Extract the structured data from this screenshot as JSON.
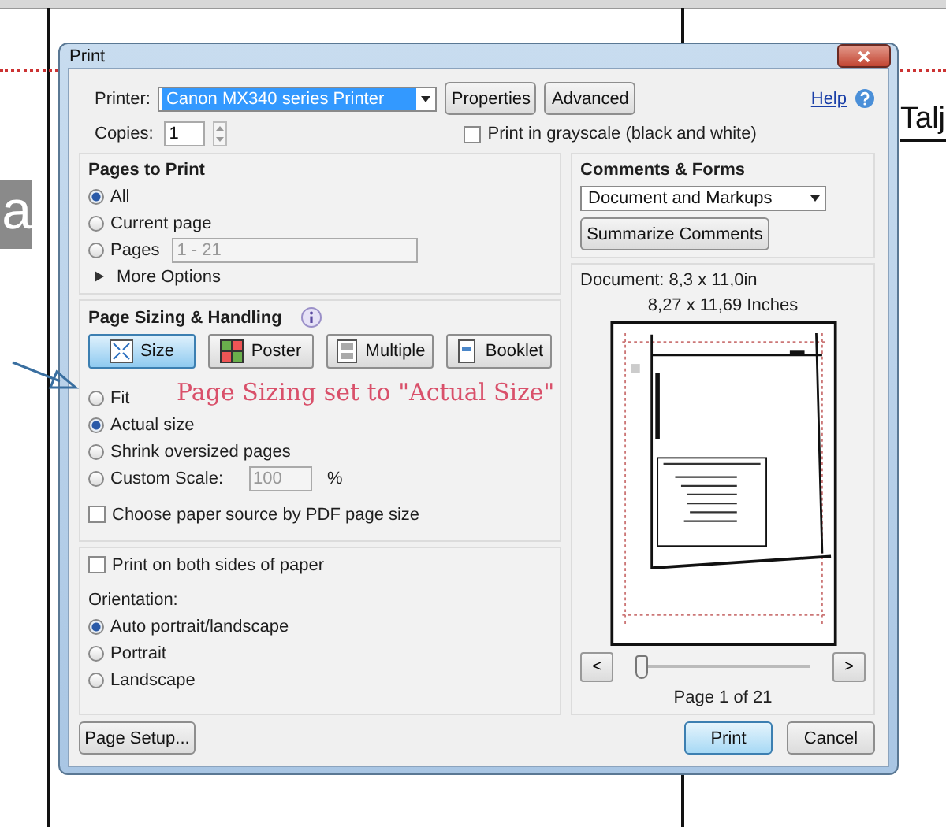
{
  "document": {
    "side_text": "a",
    "heading": "Talj"
  },
  "dialog": {
    "title": "Print",
    "printer": {
      "label": "Printer:",
      "value": "Canon MX340 series Printer"
    },
    "top_buttons": [
      "Properties",
      "Advanced"
    ],
    "help": "Help",
    "copies": {
      "label": "Copies:",
      "value": "1"
    },
    "grayscale": {
      "label": "Print in grayscale (black and white)",
      "checked": false
    },
    "pages_to_print": {
      "title": "Pages to Print",
      "options": [
        {
          "label": "All",
          "selected": true
        },
        {
          "label": "Current page",
          "selected": false
        },
        {
          "label": "Pages",
          "selected": false,
          "field": "1 - 21",
          "disabled": true
        }
      ],
      "more_options": "More Options"
    },
    "page_sizing": {
      "title": "Page Sizing & Handling",
      "modes": [
        {
          "label": "Size",
          "selected": true
        },
        {
          "label": "Poster",
          "selected": false
        },
        {
          "label": "Multiple",
          "selected": false
        },
        {
          "label": "Booklet",
          "selected": false
        }
      ],
      "options": [
        {
          "label": "Fit",
          "selected": false
        },
        {
          "label": "Actual size",
          "selected": true
        },
        {
          "label": "Shrink oversized pages",
          "selected": false
        },
        {
          "label": "Custom Scale:",
          "selected": false,
          "field": "100",
          "unit": "%",
          "disabled": true
        }
      ],
      "paper_source": {
        "label": "Choose paper source by PDF page size",
        "checked": false
      }
    },
    "duplex": {
      "label": "Print on both sides of paper",
      "checked": false
    },
    "orientation": {
      "title": "Orientation:",
      "options": [
        {
          "label": "Auto portrait/landscape",
          "selected": true
        },
        {
          "label": "Portrait",
          "selected": false
        },
        {
          "label": "Landscape",
          "selected": false
        }
      ]
    },
    "comments": {
      "title": "Comments & Forms",
      "value": "Document and Markups",
      "button": "Summarize Comments"
    },
    "document_size": "Document: 8,3 x 11,0in",
    "paper_size": "8,27 x 11,69 Inches",
    "preview": {
      "prev": "<",
      "next": ">",
      "level": 0,
      "page": "Page 1 of 21"
    },
    "page_setup": "Page Setup...",
    "print": "Print",
    "cancel": "Cancel"
  },
  "annotation": "Page Sizing set to \"Actual Size\""
}
